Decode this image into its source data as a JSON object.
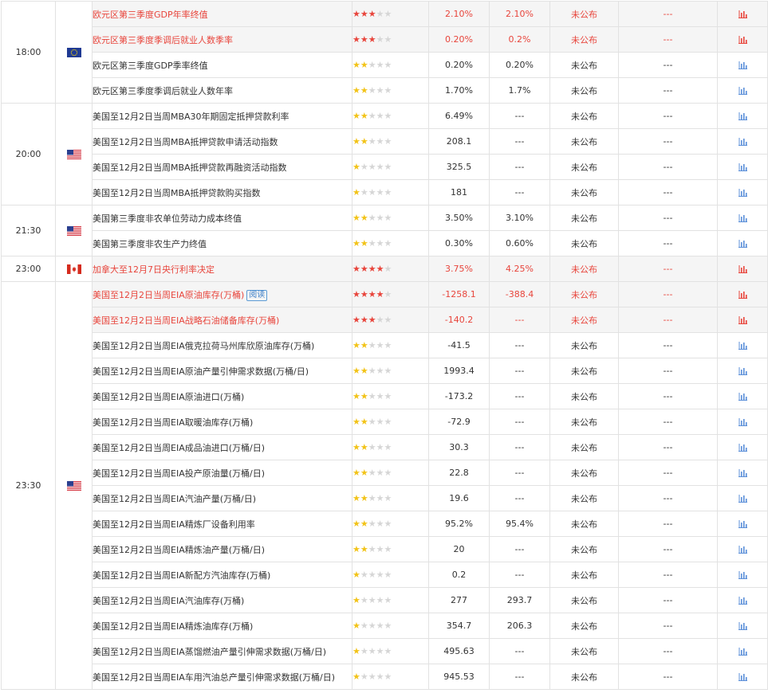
{
  "colors": {
    "highlight": "#e8453c",
    "star_on": "#f2c318",
    "star_off": "#d6d6d6",
    "chart_icon_blue": "#5b8fd9",
    "chart_icon_red": "#e8453c"
  },
  "groups": [
    {
      "time": "18:00",
      "flag": "EU",
      "rows": [
        {
          "name": "欧元区第三季度GDP年率终值",
          "stars": 3,
          "important": true,
          "prev": "2.10%",
          "forecast": "2.10%",
          "actual": "未公布",
          "impact": "---"
        },
        {
          "name": "欧元区第三季度季调后就业人数季率",
          "stars": 3,
          "important": true,
          "prev": "0.20%",
          "forecast": "0.2%",
          "actual": "未公布",
          "impact": "---"
        },
        {
          "name": "欧元区第三季度GDP季率终值",
          "stars": 2,
          "important": false,
          "prev": "0.20%",
          "forecast": "0.20%",
          "actual": "未公布",
          "impact": "---"
        },
        {
          "name": "欧元区第三季度季调后就业人数年率",
          "stars": 2,
          "important": false,
          "prev": "1.70%",
          "forecast": "1.7%",
          "actual": "未公布",
          "impact": "---"
        }
      ]
    },
    {
      "time": "20:00",
      "flag": "US",
      "rows": [
        {
          "name": "美国至12月2日当周MBA30年期固定抵押贷款利率",
          "stars": 2,
          "important": false,
          "prev": "6.49%",
          "forecast": "---",
          "actual": "未公布",
          "impact": "---"
        },
        {
          "name": "美国至12月2日当周MBA抵押贷款申请活动指数",
          "stars": 2,
          "important": false,
          "prev": "208.1",
          "forecast": "---",
          "actual": "未公布",
          "impact": "---"
        },
        {
          "name": "美国至12月2日当周MBA抵押贷款再融资活动指数",
          "stars": 1,
          "important": false,
          "prev": "325.5",
          "forecast": "---",
          "actual": "未公布",
          "impact": "---"
        },
        {
          "name": "美国至12月2日当周MBA抵押贷款购买指数",
          "stars": 1,
          "important": false,
          "prev": "181",
          "forecast": "---",
          "actual": "未公布",
          "impact": "---"
        }
      ]
    },
    {
      "time": "21:30",
      "flag": "US",
      "rows": [
        {
          "name": "美国第三季度非农单位劳动力成本终值",
          "stars": 2,
          "important": false,
          "prev": "3.50%",
          "forecast": "3.10%",
          "actual": "未公布",
          "impact": "---"
        },
        {
          "name": "美国第三季度非农生产力终值",
          "stars": 2,
          "important": false,
          "prev": "0.30%",
          "forecast": "0.60%",
          "actual": "未公布",
          "impact": "---"
        }
      ]
    },
    {
      "time": "23:00",
      "flag": "CA",
      "rows": [
        {
          "name": "加拿大至12月7日央行利率决定",
          "stars": 4,
          "important": true,
          "prev": "3.75%",
          "forecast": "4.25%",
          "actual": "未公布",
          "impact": "---"
        }
      ]
    },
    {
      "time": "23:30",
      "flag": "US",
      "rows": [
        {
          "name": "美国至12月2日当周EIA原油库存(万桶)",
          "tag": "阅读",
          "stars": 4,
          "important": true,
          "prev": "-1258.1",
          "forecast": "-388.4",
          "actual": "未公布",
          "impact": "---"
        },
        {
          "name": "美国至12月2日当周EIA战略石油储备库存(万桶)",
          "stars": 3,
          "important": true,
          "prev": "-140.2",
          "forecast": "---",
          "actual": "未公布",
          "impact": "---"
        },
        {
          "name": "美国至12月2日当周EIA俄克拉荷马州库欣原油库存(万桶)",
          "stars": 2,
          "important": false,
          "prev": "-41.5",
          "forecast": "---",
          "actual": "未公布",
          "impact": "---"
        },
        {
          "name": "美国至12月2日当周EIA原油产量引伸需求数据(万桶/日)",
          "stars": 2,
          "important": false,
          "prev": "1993.4",
          "forecast": "---",
          "actual": "未公布",
          "impact": "---"
        },
        {
          "name": "美国至12月2日当周EIA原油进口(万桶)",
          "stars": 2,
          "important": false,
          "prev": "-173.2",
          "forecast": "---",
          "actual": "未公布",
          "impact": "---"
        },
        {
          "name": "美国至12月2日当周EIA取暖油库存(万桶)",
          "stars": 2,
          "important": false,
          "prev": "-72.9",
          "forecast": "---",
          "actual": "未公布",
          "impact": "---"
        },
        {
          "name": "美国至12月2日当周EIA成品油进口(万桶/日)",
          "stars": 2,
          "important": false,
          "prev": "30.3",
          "forecast": "---",
          "actual": "未公布",
          "impact": "---"
        },
        {
          "name": "美国至12月2日当周EIA投产原油量(万桶/日)",
          "stars": 2,
          "important": false,
          "prev": "22.8",
          "forecast": "---",
          "actual": "未公布",
          "impact": "---"
        },
        {
          "name": "美国至12月2日当周EIA汽油产量(万桶/日)",
          "stars": 2,
          "important": false,
          "prev": "19.6",
          "forecast": "---",
          "actual": "未公布",
          "impact": "---"
        },
        {
          "name": "美国至12月2日当周EIA精炼厂设备利用率",
          "stars": 2,
          "important": false,
          "prev": "95.2%",
          "forecast": "95.4%",
          "actual": "未公布",
          "impact": "---"
        },
        {
          "name": "美国至12月2日当周EIA精炼油产量(万桶/日)",
          "stars": 2,
          "important": false,
          "prev": "20",
          "forecast": "---",
          "actual": "未公布",
          "impact": "---"
        },
        {
          "name": "美国至12月2日当周EIA新配方汽油库存(万桶)",
          "stars": 1,
          "important": false,
          "prev": "0.2",
          "forecast": "---",
          "actual": "未公布",
          "impact": "---"
        },
        {
          "name": "美国至12月2日当周EIA汽油库存(万桶)",
          "stars": 1,
          "important": false,
          "prev": "277",
          "forecast": "293.7",
          "actual": "未公布",
          "impact": "---"
        },
        {
          "name": "美国至12月2日当周EIA精炼油库存(万桶)",
          "stars": 1,
          "important": false,
          "prev": "354.7",
          "forecast": "206.3",
          "actual": "未公布",
          "impact": "---"
        },
        {
          "name": "美国至12月2日当周EIA蒸馏燃油产量引伸需求数据(万桶/日)",
          "stars": 1,
          "important": false,
          "prev": "495.63",
          "forecast": "---",
          "actual": "未公布",
          "impact": "---"
        },
        {
          "name": "美国至12月2日当周EIA车用汽油总产量引伸需求数据(万桶/日)",
          "stars": 1,
          "important": false,
          "prev": "945.53",
          "forecast": "---",
          "actual": "未公布",
          "impact": "---"
        }
      ]
    }
  ]
}
